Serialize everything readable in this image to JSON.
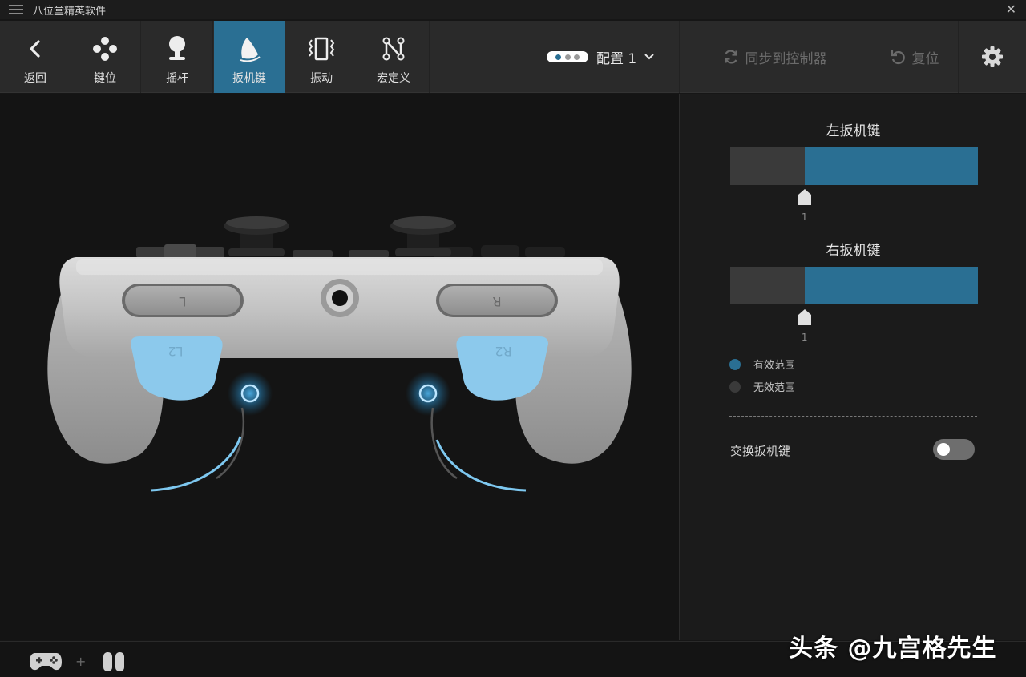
{
  "window": {
    "title": "八位堂精英软件"
  },
  "tabs": [
    {
      "id": "back",
      "label": "返回",
      "icon": "chevron-left-icon"
    },
    {
      "id": "keys",
      "label": "键位",
      "icon": "dpad-icon"
    },
    {
      "id": "stick",
      "label": "摇杆",
      "icon": "joystick-icon"
    },
    {
      "id": "trigger",
      "label": "扳机键",
      "icon": "trigger-icon",
      "active": true
    },
    {
      "id": "vibration",
      "label": "振动",
      "icon": "vibration-icon"
    },
    {
      "id": "macro",
      "label": "宏定义",
      "icon": "macro-icon"
    }
  ],
  "toolbar": {
    "config_name": "配置 1",
    "sync_label": "同步到控制器",
    "reset_label": "复位"
  },
  "panel": {
    "left_trigger": {
      "title": "左扳机键",
      "value": "1",
      "effective_fraction": 0.7
    },
    "right_trigger": {
      "title": "右扳机键",
      "value": "1",
      "effective_fraction": 0.7
    },
    "legend_effective": "有效范围",
    "legend_ineffective": "无效范围",
    "swap_label": "交换扳机键",
    "swap_enabled": false
  },
  "controller": {
    "bumper_left": "L",
    "bumper_right": "R",
    "trigger_left": "L2",
    "trigger_right": "R2"
  },
  "watermark": "头条 @九宫格先生",
  "colors": {
    "accent": "#2a6f93",
    "trigger_blue": "#8cc9ec",
    "glow": "#4fb6f0"
  }
}
